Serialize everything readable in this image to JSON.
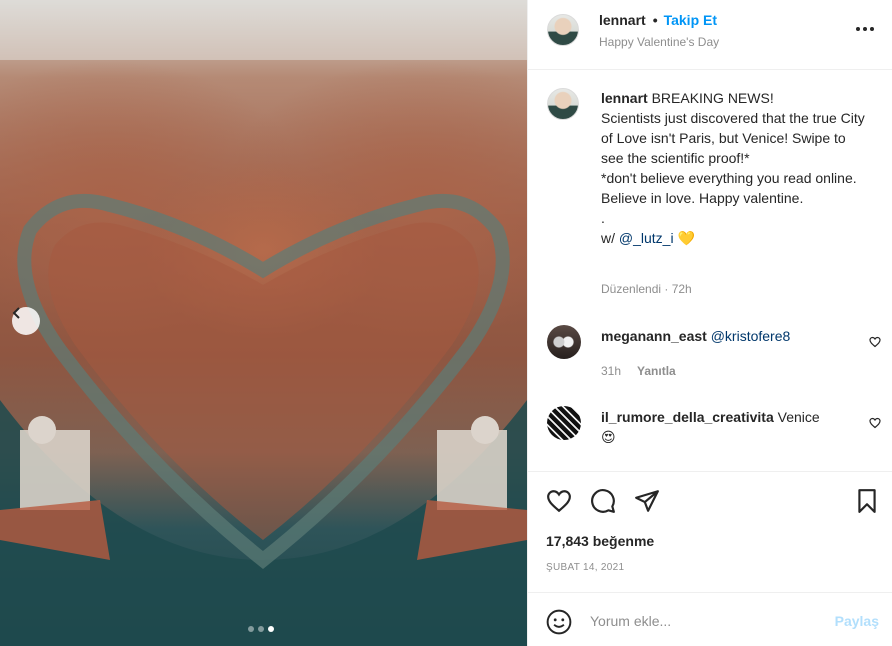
{
  "post": {
    "dots": 3,
    "active_dot": 3
  },
  "header": {
    "username": "lennart",
    "separator": "•",
    "follow_label": "Takip Et",
    "subtitle": "Happy Valentine's Day"
  },
  "caption": {
    "username": "lennart",
    "line1": "BREAKING NEWS!",
    "line2": "Scientists just discovered that the true City of Love isn't Paris, but Venice! Swipe to see the scientific proof!*",
    "line3": "*don't believe everything you read online. Believe in love. Happy valentine.",
    "line4": ".",
    "w_prefix": "w/ ",
    "mention": "@_lutz_i",
    "emoji": "💛",
    "edited": "Düzenlendi · 72h"
  },
  "comments": [
    {
      "username": "meganann_east",
      "mention": "@kristofere8",
      "time": "31h",
      "reply_label": "Yanıtla"
    },
    {
      "username": "il_rumore_della_creativita",
      "text": "Venice",
      "emoji": "😍"
    }
  ],
  "stats": {
    "likes": "17,843 beğenme",
    "date": "ŞUBAT 14, 2021"
  },
  "add_comment": {
    "placeholder": "Yorum ekle...",
    "post_label": "Paylaş"
  },
  "icons": {
    "prev": "chevron-left-icon",
    "more": "more-horizontal-icon",
    "like": "heart-icon",
    "comment": "comment-icon",
    "share": "send-icon",
    "save": "bookmark-icon",
    "emoji": "smiley-icon"
  },
  "colors": {
    "link": "#0095f6",
    "mention": "#00376b",
    "muted": "#8e8e8e",
    "post_disabled": "#b2dffc"
  }
}
